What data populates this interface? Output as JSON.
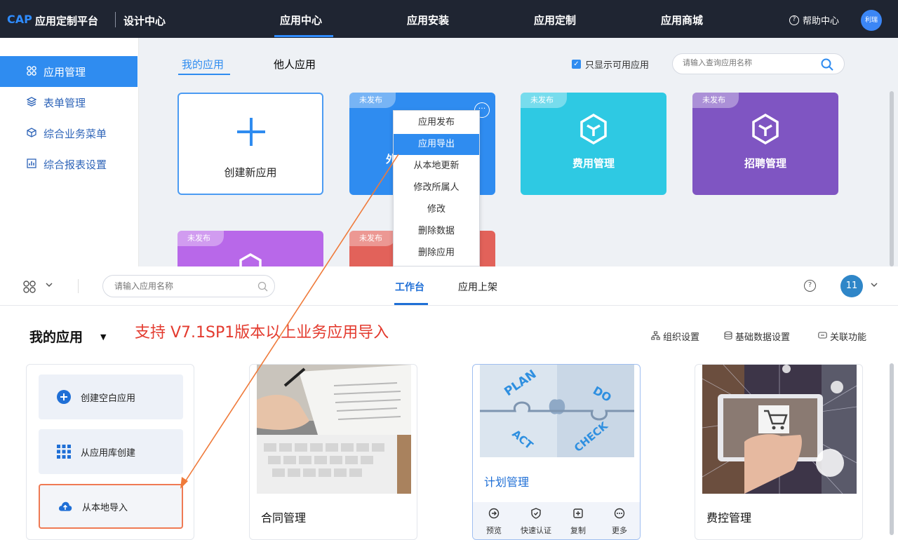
{
  "top": {
    "brand_cap": "CAP",
    "brand_name": "应用定制平台",
    "brand_sub": "设计中心",
    "nav": [
      "应用中心",
      "应用安装",
      "应用定制",
      "应用商城"
    ],
    "help": "帮助中心",
    "avatar": "利瑞",
    "sidebar": [
      "应用管理",
      "表单管理",
      "综合业务菜单",
      "综合报表设置"
    ],
    "tabs": [
      "我的应用",
      "他人应用"
    ],
    "only_available": "只显示可用应用",
    "search_placeholder": "请输入查询应用名称",
    "create_new": "创建新应用",
    "badge": "未发布",
    "cards": [
      {
        "name": "费用管理",
        "color": "#2ec9e3"
      },
      {
        "name": "招聘管理",
        "color": "#7f55c2"
      }
    ],
    "partial_card_char": "外",
    "context_menu": [
      "应用发布",
      "应用导出",
      "从本地更新",
      "修改所属人",
      "修改",
      "删除数据",
      "删除应用"
    ]
  },
  "bottom": {
    "search_placeholder": "请输入应用名称",
    "tabs": [
      "工作台",
      "应用上架"
    ],
    "avatar": "11",
    "my_apps": "我的应用",
    "note": "支持 V7.1SP1版本以上业务应用导入",
    "toolbar": [
      "组织设置",
      "基础数据设置",
      "关联功能"
    ],
    "create_options": [
      "创建空白应用",
      "从应用库创建",
      "从本地导入"
    ],
    "apps": [
      "合同管理",
      "计划管理",
      "费控管理"
    ],
    "plan_actions": [
      "预览",
      "快速认证",
      "复制",
      "更多"
    ],
    "puzzle_words": [
      "PLAN",
      "DO",
      "ACT",
      "CHECK"
    ]
  },
  "colors": {
    "accent": "#2f8cf0",
    "topbar": "#1f2532",
    "note_red": "#e33a2e",
    "arrow": "#ef7a3a"
  }
}
